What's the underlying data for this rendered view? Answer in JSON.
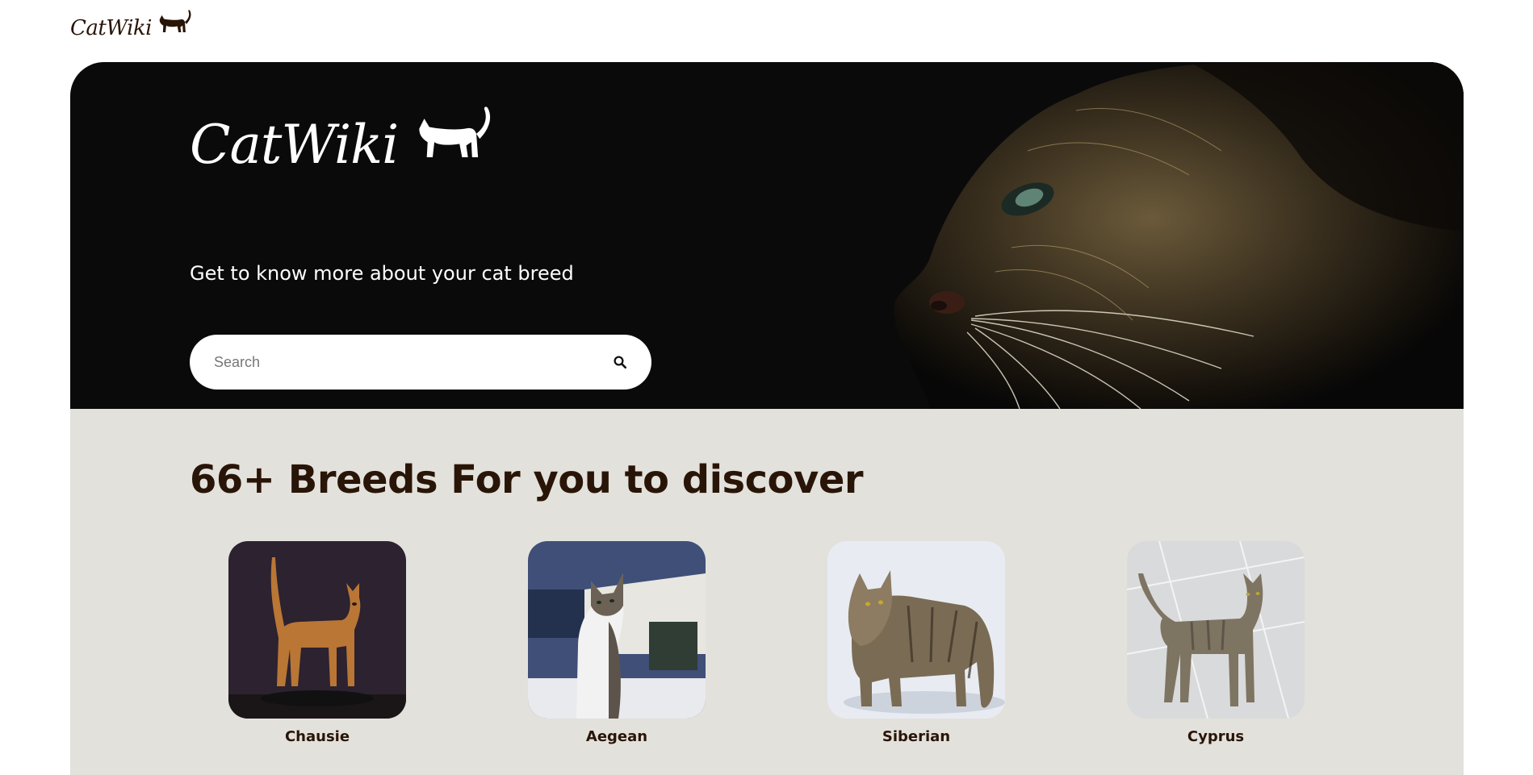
{
  "brand": {
    "name": "CatWiki",
    "logo_icon": "cat-silhouette-icon"
  },
  "hero": {
    "tagline": "Get to know more about your cat breed",
    "search": {
      "placeholder": "Search",
      "icon": "search-icon"
    },
    "image": "cat-profile-photo"
  },
  "breeds_section": {
    "title": "66+ Breeds For you to discover",
    "breeds": [
      {
        "name": "Chausie"
      },
      {
        "name": "Aegean"
      },
      {
        "name": "Siberian"
      },
      {
        "name": "Cyprus"
      }
    ]
  },
  "colors": {
    "brand_dark": "#291507",
    "hero_bg": "#0a0a0a",
    "section_bg": "#e3e1dc",
    "white": "#ffffff"
  }
}
